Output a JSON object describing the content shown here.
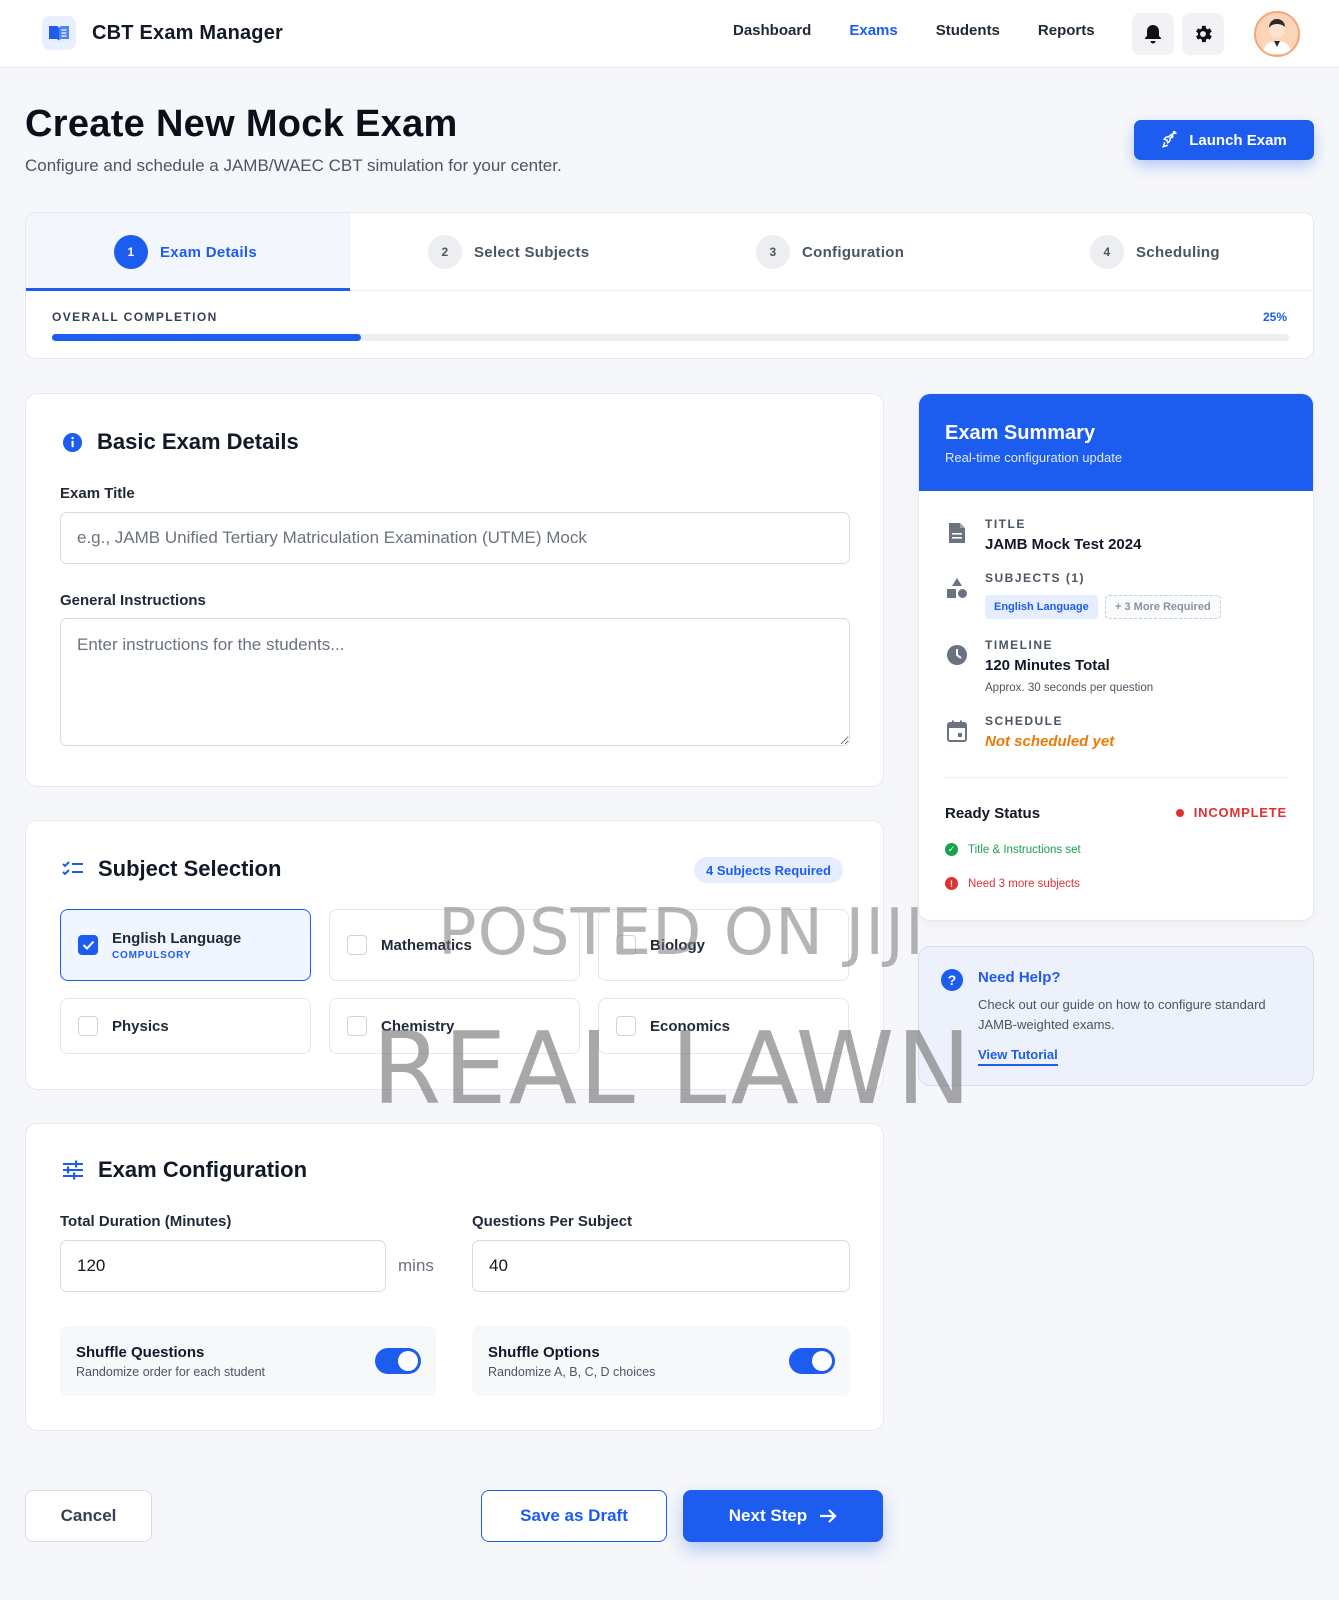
{
  "app": {
    "name": "CBT Exam Manager",
    "nav": [
      "Dashboard",
      "Exams",
      "Students",
      "Reports"
    ],
    "active_nav": "Exams"
  },
  "header": {
    "title": "Create New Mock Exam",
    "subtitle": "Configure and schedule a JAMB/WAEC CBT simulation for your center.",
    "launch_label": "Launch Exam"
  },
  "stepper": {
    "steps": [
      {
        "num": "1",
        "label": "Exam Details"
      },
      {
        "num": "2",
        "label": "Select Subjects"
      },
      {
        "num": "3",
        "label": "Configuration"
      },
      {
        "num": "4",
        "label": "Scheduling"
      }
    ],
    "completion_label": "OVERALL COMPLETION",
    "completion_text": "25%",
    "completion_value": 0.25
  },
  "basic": {
    "title": "Basic Exam Details",
    "exam_title_label": "Exam Title",
    "exam_title_placeholder": "e.g., JAMB Unified Tertiary Matriculation Examination (UTME) Mock",
    "instructions_label": "General Instructions",
    "instructions_placeholder": "Enter instructions for the students..."
  },
  "subjects": {
    "title": "Subject Selection",
    "required_badge": "4 Subjects Required",
    "items": [
      {
        "name": "English Language",
        "tag": "COMPULSORY"
      },
      {
        "name": "Mathematics"
      },
      {
        "name": "Biology"
      },
      {
        "name": "Physics"
      },
      {
        "name": "Chemistry"
      },
      {
        "name": "Economics"
      }
    ]
  },
  "config": {
    "title": "Exam Configuration",
    "duration_label": "Total Duration (Minutes)",
    "duration_value": "120",
    "duration_unit": "mins",
    "questions_label": "Questions Per Subject",
    "questions_value": "40",
    "shuffle_questions_title": "Shuffle Questions",
    "shuffle_questions_sub": "Randomize order for each student",
    "shuffle_options_title": "Shuffle Options",
    "shuffle_options_sub": "Randomize A, B, C, D choices"
  },
  "footer": {
    "cancel": "Cancel",
    "draft": "Save as Draft",
    "next": "Next Step"
  },
  "summary": {
    "title": "Exam Summary",
    "subtitle": "Real-time configuration update",
    "title_label": "TITLE",
    "title_value": "JAMB Mock Test 2024",
    "subjects_label": "SUBJECTS (1)",
    "subject_chip": "English Language",
    "more_chip": "+ 3 More Required",
    "timeline_label": "TIMELINE",
    "timeline_value": "120 Minutes Total",
    "timeline_note": "Approx. 30 seconds per question",
    "schedule_label": "SCHEDULE",
    "schedule_value": "Not scheduled yet",
    "ready_label": "Ready Status",
    "ready_status": "INCOMPLETE",
    "check_ok": "Title & Instructions set",
    "check_err": "Need 3 more subjects"
  },
  "help": {
    "title": "Need Help?",
    "body": "Check out our guide on how to configure standard JAMB-weighted exams.",
    "link": "View Tutorial"
  },
  "watermark": {
    "line1": "POSTED ON JIJI",
    "line2": "REAL LAWN"
  },
  "colors": {
    "accent": "#1c5df0",
    "danger": "#e03131",
    "success": "#16a34a",
    "warning": "#ea7a0b"
  }
}
